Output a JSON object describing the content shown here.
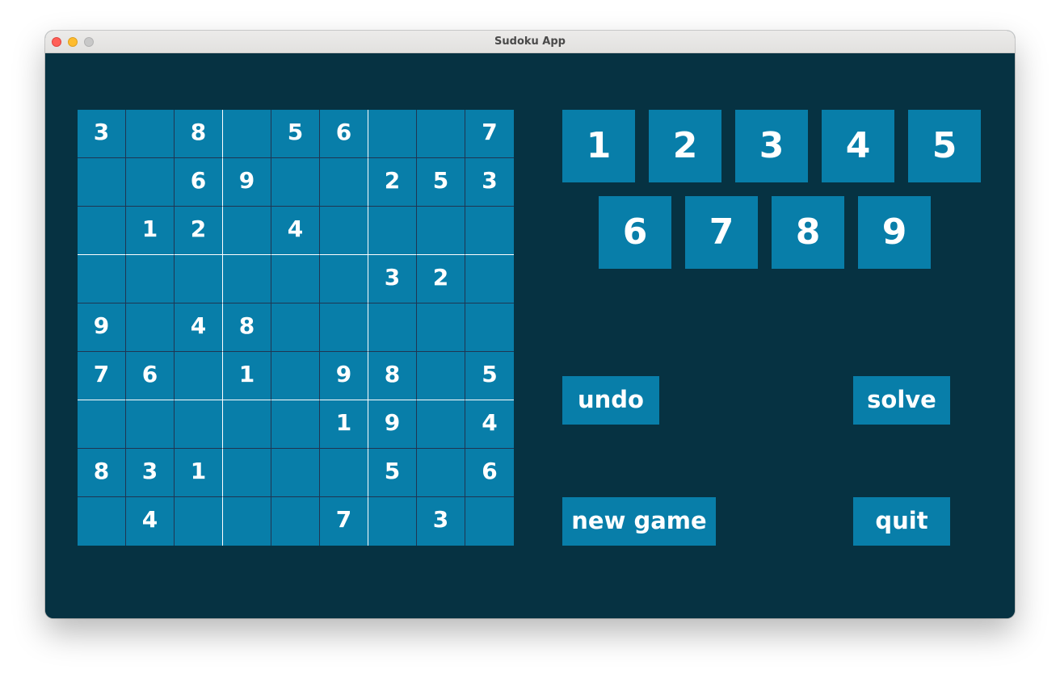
{
  "window": {
    "title": "Sudoku App"
  },
  "colors": {
    "background": "#063242",
    "cell": "#087ea9",
    "text": "#ffffff",
    "grid_line": "#1f3552",
    "box_line": "#ffffff"
  },
  "board": [
    [
      "3",
      "",
      "8",
      "",
      "5",
      "6",
      "",
      "",
      "7"
    ],
    [
      "",
      "",
      "6",
      "9",
      "",
      "",
      "2",
      "5",
      "3"
    ],
    [
      "",
      "1",
      "2",
      "",
      "4",
      "",
      "",
      "",
      ""
    ],
    [
      "",
      "",
      "",
      "",
      "",
      "",
      "3",
      "2",
      ""
    ],
    [
      "9",
      "",
      "4",
      "8",
      "",
      "",
      "",
      "",
      ""
    ],
    [
      "7",
      "6",
      "",
      "1",
      "",
      "9",
      "8",
      "",
      "5"
    ],
    [
      "",
      "",
      "",
      "",
      "",
      "1",
      "9",
      "",
      "4"
    ],
    [
      "8",
      "3",
      "1",
      "",
      "",
      "",
      "5",
      "",
      "6"
    ],
    [
      "",
      "4",
      "",
      "",
      "",
      "7",
      "",
      "3",
      ""
    ]
  ],
  "numpad": [
    "1",
    "2",
    "3",
    "4",
    "5",
    "6",
    "7",
    "8",
    "9"
  ],
  "actions": {
    "undo": "undo",
    "solve": "solve",
    "new_game": "new game",
    "quit": "quit"
  }
}
